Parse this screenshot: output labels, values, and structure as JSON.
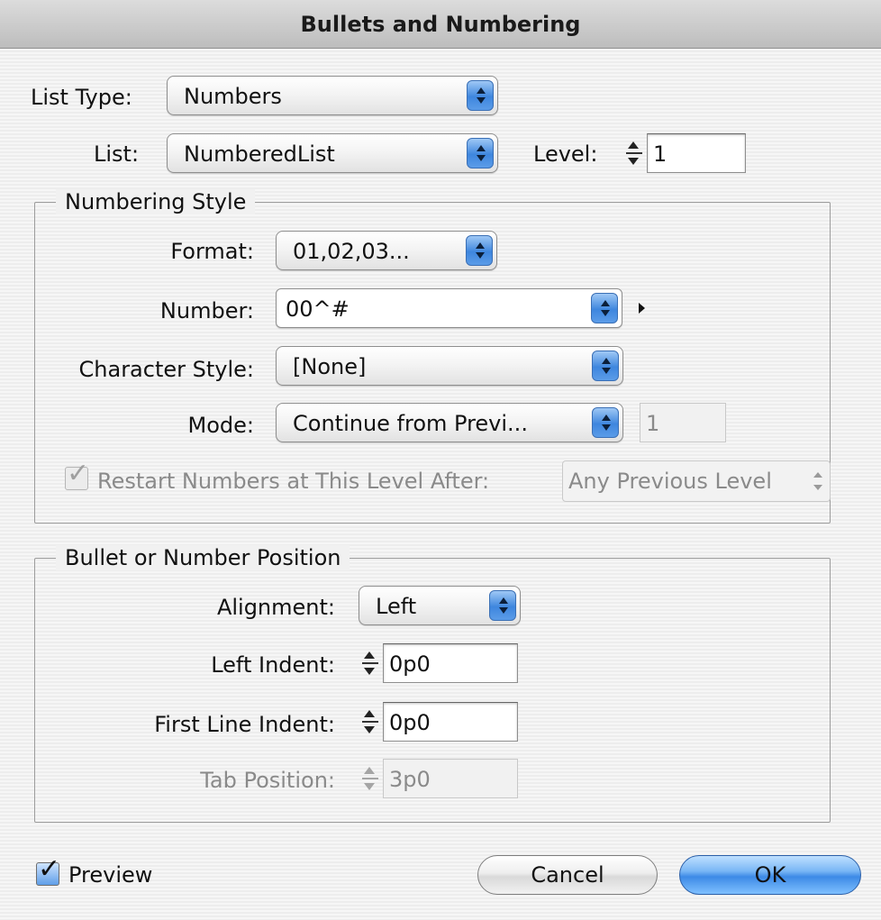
{
  "dialog": {
    "title": "Bullets and Numbering"
  },
  "top": {
    "list_type_label": "List Type:",
    "list_type_value": "Numbers",
    "list_label": "List:",
    "list_value": "NumberedList",
    "level_label": "Level:",
    "level_value": "1"
  },
  "numbering_style": {
    "legend": "Numbering Style",
    "format_label": "Format:",
    "format_value": "01,02,03...",
    "number_label": "Number:",
    "number_value": "00^#",
    "char_style_label": "Character Style:",
    "char_style_value": "[None]",
    "mode_label": "Mode:",
    "mode_value": "Continue from Previ...",
    "mode_start_value": "1",
    "restart_label": "Restart Numbers at This Level After:",
    "restart_checked": true,
    "restart_after_value": "Any Previous Level"
  },
  "position": {
    "legend": "Bullet or Number Position",
    "alignment_label": "Alignment:",
    "alignment_value": "Left",
    "left_indent_label": "Left Indent:",
    "left_indent_value": "0p0",
    "first_line_label": "First Line Indent:",
    "first_line_value": "0p0",
    "tab_position_label": "Tab Position:",
    "tab_position_value": "3p0"
  },
  "footer": {
    "preview_label": "Preview",
    "preview_checked": true,
    "cancel_label": "Cancel",
    "ok_label": "OK"
  },
  "colors": {
    "accent": "#3d8ae6",
    "disabled_text": "#8a8a8a"
  }
}
